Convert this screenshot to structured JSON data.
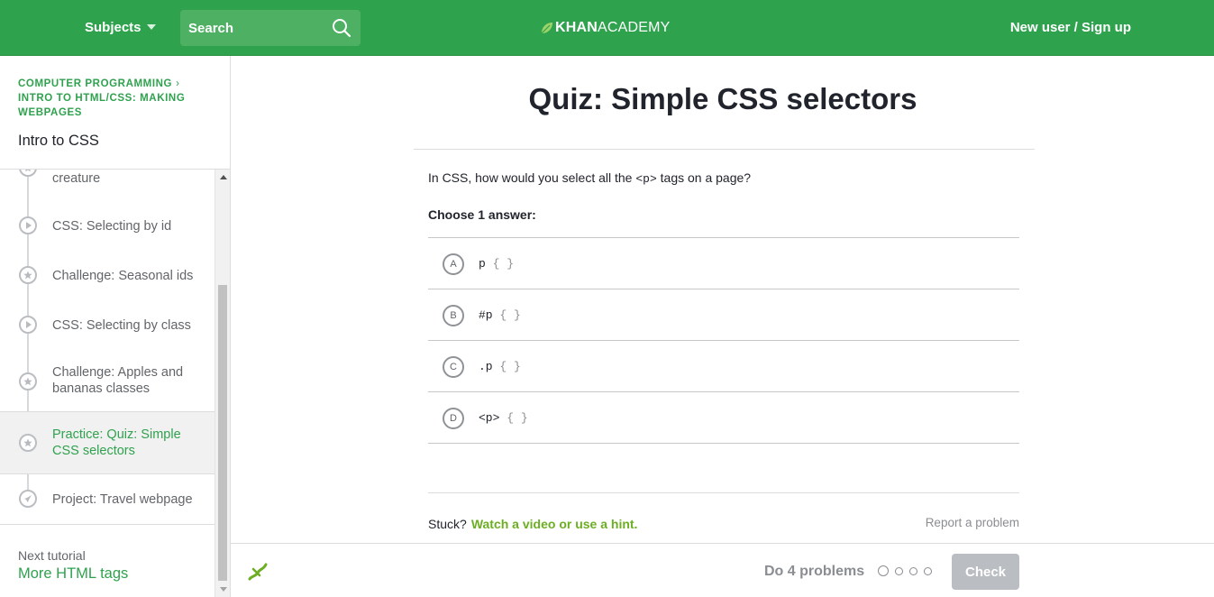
{
  "header": {
    "subjects_label": "Subjects",
    "search_placeholder": "Search",
    "logo_khan": "KHAN",
    "logo_academy": "ACADEMY",
    "signup_label": "New user / Sign up"
  },
  "sidebar": {
    "breadcrumb_1": "COMPUTER PROGRAMMING",
    "breadcrumb_2": "INTRO TO HTML/CSS: MAKING WEBPAGES",
    "title": "Intro to CSS",
    "items": [
      {
        "label": "creature",
        "icon": "star-icon"
      },
      {
        "label": "CSS: Selecting by id",
        "icon": "play-icon"
      },
      {
        "label": "Challenge: Seasonal ids",
        "icon": "star-icon"
      },
      {
        "label": "CSS: Selecting by class",
        "icon": "play-icon"
      },
      {
        "label": "Challenge: Apples and bananas classes",
        "icon": "star-icon"
      },
      {
        "label": "Practice: Quiz: Simple CSS selectors",
        "icon": "star-icon",
        "active": true
      },
      {
        "label": "Project: Travel webpage",
        "icon": "rocket-icon"
      }
    ],
    "next_label": "Next tutorial",
    "next_link": "More HTML tags"
  },
  "quiz": {
    "title": "Quiz: Simple CSS selectors",
    "question_before": "In CSS, how would you select all the ",
    "question_code": "<p>",
    "question_after": " tags on a page?",
    "choose_label": "Choose 1 answer:",
    "answers": [
      {
        "letter": "A",
        "selector": "p",
        "braces": "{ }"
      },
      {
        "letter": "B",
        "selector": "#p",
        "braces": "{ }"
      },
      {
        "letter": "C",
        "selector": ".p",
        "braces": "{ }"
      },
      {
        "letter": "D",
        "selector": "<p>",
        "braces": "{ }"
      }
    ],
    "stuck_label": "Stuck?",
    "hint_label": "Watch a video or use a hint.",
    "report_label": "Report a problem"
  },
  "footer": {
    "do_problems": "Do 4 problems",
    "check_label": "Check"
  },
  "colors": {
    "brand_green": "#2fa24e",
    "hint_green": "#6cae23",
    "disabled_button": "#babec2"
  }
}
